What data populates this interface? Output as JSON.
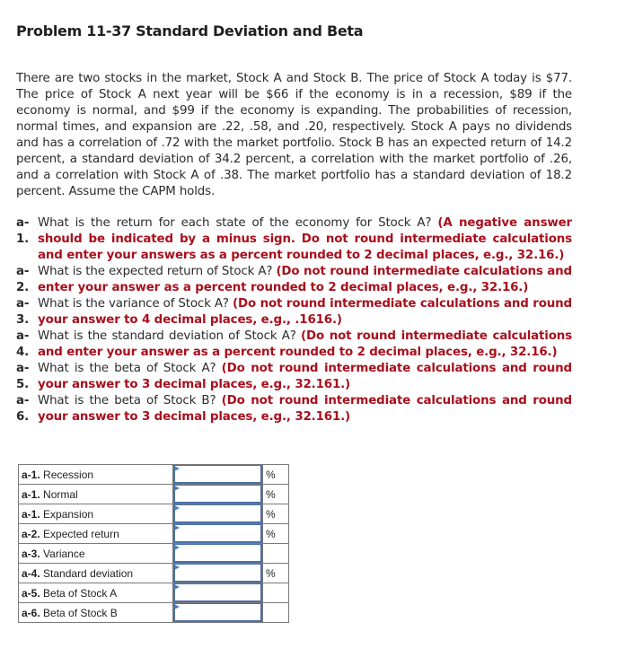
{
  "page": {
    "title": "Problem 11-37 Standard Deviation and Beta"
  },
  "intro": "There are two stocks in the market, Stock A and Stock B. The price of Stock A today is $77. The price of Stock A next year will be $66 if the economy is in a recession, $89 if the economy is normal, and $99 if the economy is expanding. The probabilities of recession, normal times, and expansion are .22, .58, and .20, respectively. Stock A pays no dividends and has a correlation of .72 with the market portfolio. Stock B has an expected return of 14.2 percent, a standard deviation of 34.2 percent, a correlation with the market portfolio of .26, and a correlation with Stock A of .38. The market portfolio has a standard deviation of 18.2 percent. Assume the CAPM holds.",
  "questions": [
    {
      "label_top": "a-1.",
      "label_bottom": "",
      "text": "What is the return for each state of the economy for Stock A?",
      "note": "(A negative answer should be indicated by a minus sign. Do not round intermediate calculations and enter your answers as a percent rounded to 2 decimal places, e.g., 32.16.)"
    },
    {
      "label_top": "a-",
      "label_bottom": "2.",
      "text": "What is the expected return of Stock A?",
      "note": "(Do not round intermediate calculations and enter your answer as a percent rounded to 2 decimal places, e.g., 32.16.)"
    },
    {
      "label_top": "a-",
      "label_bottom": "3.",
      "text": "What is the variance of Stock A?",
      "note": "(Do not round intermediate calculations and round your answer to 4 decimal places, e.g., .1616.)"
    },
    {
      "label_top": "a-",
      "label_bottom": "4.",
      "text": "What is the standard deviation of Stock A?",
      "note": "(Do not round intermediate calculations and enter your answer as a percent rounded to 2 decimal places, e.g., 32.16.)"
    },
    {
      "label_top": "a-",
      "label_bottom": "5.",
      "text": "What is the beta of Stock A?",
      "note": "(Do not round intermediate calculations and round your answer to 3 decimal places, e.g., 32.161.)"
    },
    {
      "label_top": "a-",
      "label_bottom": "6.",
      "text": "What is the beta of Stock B?",
      "note": "(Do not round intermediate calculations and round your answer to 3 decimal places, e.g., 32.161.)"
    }
  ],
  "answers": [
    {
      "prefix": "a-1.",
      "label": "Recession",
      "value": "",
      "unit": "%"
    },
    {
      "prefix": "a-1.",
      "label": "Normal",
      "value": "",
      "unit": "%"
    },
    {
      "prefix": "a-1.",
      "label": "Expansion",
      "value": "",
      "unit": "%"
    },
    {
      "prefix": "a-2.",
      "label": "Expected return",
      "value": "",
      "unit": "%"
    },
    {
      "prefix": "a-3.",
      "label": "Variance",
      "value": "",
      "unit": ""
    },
    {
      "prefix": "a-4.",
      "label": "Standard deviation",
      "value": "",
      "unit": "%"
    },
    {
      "prefix": "a-5.",
      "label": "Beta of Stock A",
      "value": "",
      "unit": ""
    },
    {
      "prefix": "a-6.",
      "label": "Beta of Stock B",
      "value": "",
      "unit": ""
    }
  ],
  "colors": {
    "note_red": "#a8101d",
    "input_border_blue": "#4a6fa5",
    "flag_blue": "#4a7ec0"
  }
}
